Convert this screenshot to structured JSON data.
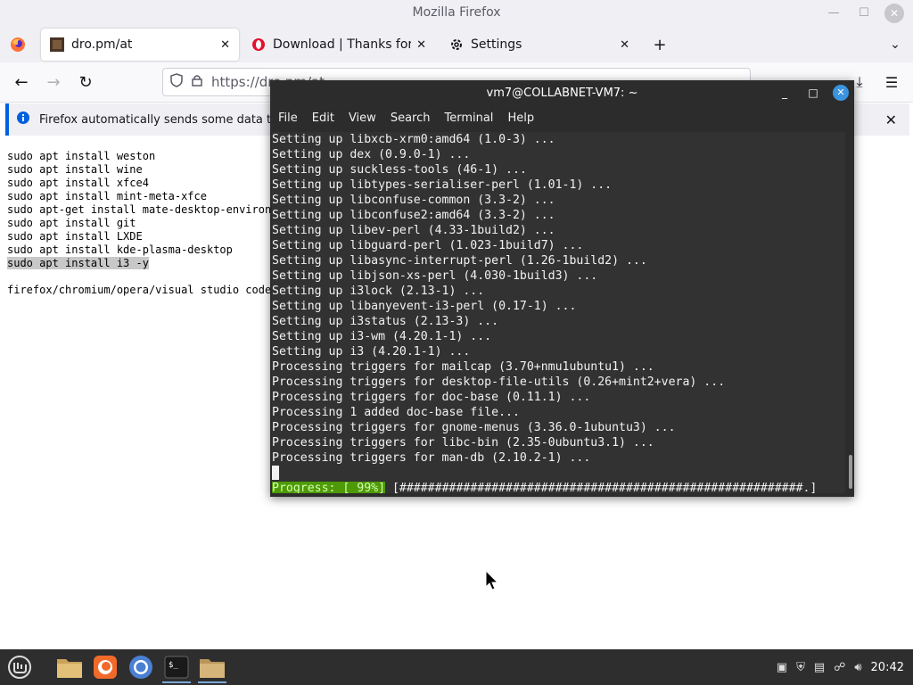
{
  "window_title": "Mozilla Firefox",
  "tabs": [
    {
      "title": "dro.pm/at",
      "active": true
    },
    {
      "title": "Download | Thanks for dow",
      "active": false
    },
    {
      "title": "Settings",
      "active": false
    }
  ],
  "urlbar": {
    "value": "https://dro.pm/at"
  },
  "notification": {
    "text": "Firefox automatically sends some data to M"
  },
  "page_lines": [
    "sudo apt install weston",
    "sudo apt install wine",
    "sudo apt install xfce4",
    "sudo apt install mint-meta-xfce",
    "sudo apt-get install mate-desktop-environ",
    "sudo apt install git",
    "sudo apt install LXDE",
    "sudo apt install kde-plasma-desktop",
    "sudo apt install i3 -y",
    "",
    "firefox/chromium/opera/visual studio code"
  ],
  "selected_line_index": 8,
  "terminal": {
    "title": "vm7@COLLABNET-VM7: ~",
    "menu": [
      "File",
      "Edit",
      "View",
      "Search",
      "Terminal",
      "Help"
    ],
    "lines": [
      "Setting up libxcb-xrm0:amd64 (1.0-3) ...",
      "Setting up dex (0.9.0-1) ...",
      "Setting up suckless-tools (46-1) ...",
      "Setting up libtypes-serialiser-perl (1.01-1) ...",
      "Setting up libconfuse-common (3.3-2) ...",
      "Setting up libconfuse2:amd64 (3.3-2) ...",
      "Setting up libev-perl (4.33-1build2) ...",
      "Setting up libguard-perl (1.023-1build7) ...",
      "Setting up libasync-interrupt-perl (1.26-1build2) ...",
      "Setting up libjson-xs-perl (4.030-1build3) ...",
      "Setting up i3lock (2.13-1) ...",
      "Setting up libanyevent-i3-perl (0.17-1) ...",
      "Setting up i3status (2.13-3) ...",
      "Setting up i3-wm (4.20.1-1) ...",
      "Setting up i3 (4.20.1-1) ...",
      "Processing triggers for mailcap (3.70+nmu1ubuntu1) ...",
      "Processing triggers for desktop-file-utils (0.26+mint2+vera) ...",
      "Processing triggers for doc-base (0.11.1) ...",
      "Processing 1 added doc-base file...",
      "Processing triggers for gnome-menus (3.36.0-1ubuntu3) ...",
      "Processing triggers for libc-bin (2.35-0ubuntu3.1) ...",
      "Processing triggers for man-db (2.10.2-1) ..."
    ],
    "progress_label": "Progress: [ 99%]",
    "progress_bar": " [#########################################################.] "
  },
  "taskbar": {
    "time": "20:42"
  }
}
